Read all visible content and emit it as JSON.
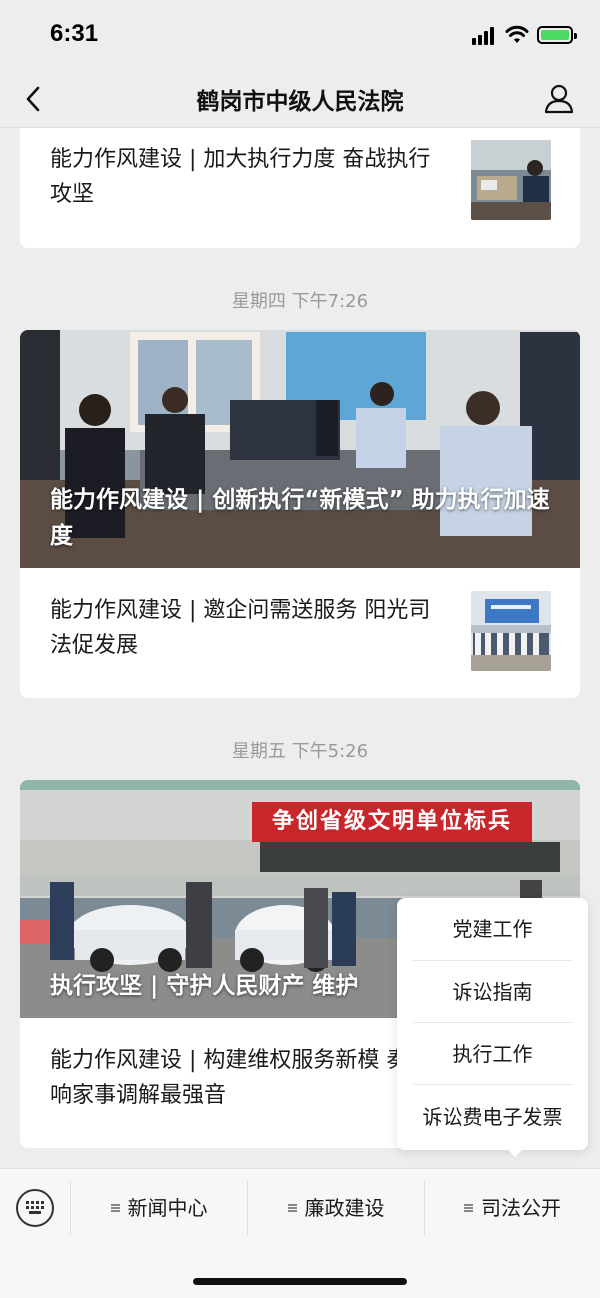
{
  "status_bar": {
    "time": "6:31"
  },
  "nav": {
    "title": "鹤岗市中级人民法院"
  },
  "feed": {
    "card1": {
      "item_title": "能力作风建设 | 加大执行力度 奋战执行攻坚"
    },
    "timestamp2": "星期四 下午7:26",
    "card2": {
      "hero_title": "能力作风建设 | 创新执行“新模式” 助力执行加速度",
      "item_title": "能力作风建设 | 邀企问需送服务 阳光司法促发展"
    },
    "timestamp3": "星期五 下午5:26",
    "card3": {
      "banner": "争创省级文明单位标兵",
      "hero_title": "执行攻坚 | 守护人民财产 维护",
      "item_title": "能力作风建设 | 构建维权服务新模 奏响家事调解最强音"
    }
  },
  "popup_menu": {
    "items": [
      "党建工作",
      "诉讼指南",
      "执行工作",
      "诉讼费电子发票"
    ]
  },
  "bottom_menu": {
    "tabs": [
      "新闻中心",
      "廉政建设",
      "司法公开"
    ]
  },
  "colors": {
    "background": "#ededed",
    "card": "#ffffff",
    "banner_red": "#c9262b",
    "battery_green": "#4cd964"
  },
  "icons": [
    "back-chevron-icon",
    "user-profile-icon",
    "keyboard-icon",
    "signal-icon",
    "wifi-icon",
    "battery-icon"
  ]
}
